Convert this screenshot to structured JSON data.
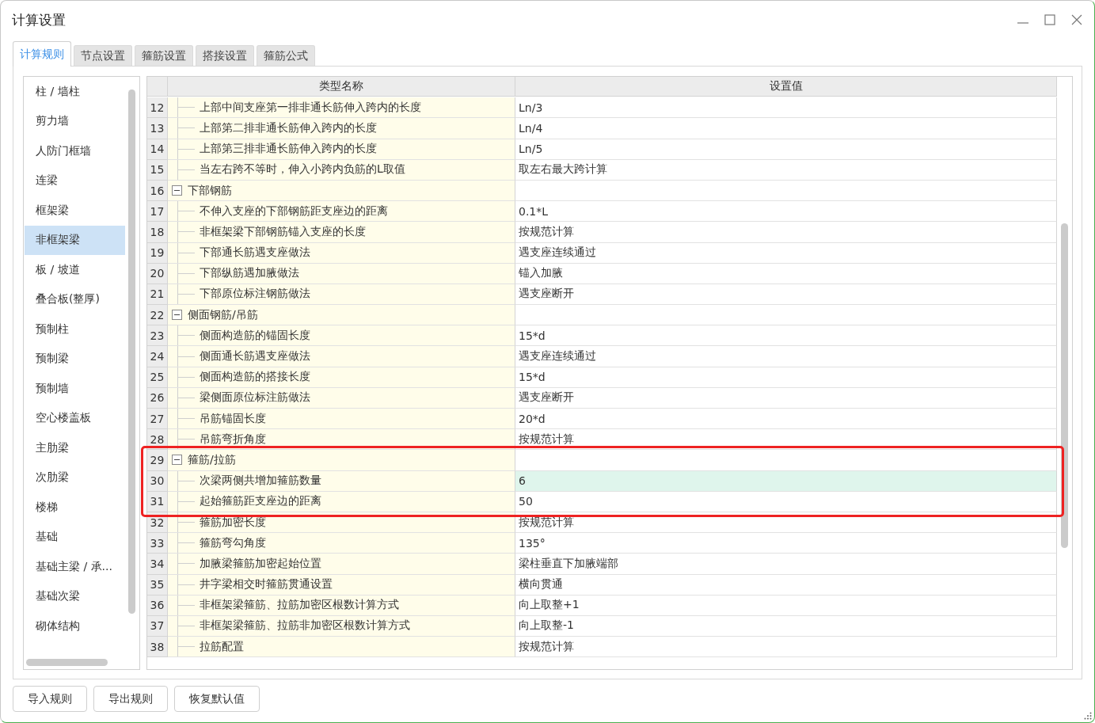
{
  "window": {
    "title": "计算设置"
  },
  "tabs": [
    {
      "label": "计算规则",
      "selected": true
    },
    {
      "label": "节点设置",
      "selected": false
    },
    {
      "label": "箍筋设置",
      "selected": false
    },
    {
      "label": "搭接设置",
      "selected": false
    },
    {
      "label": "箍筋公式",
      "selected": false
    }
  ],
  "sidebar": {
    "items": [
      {
        "label": "柱 / 墙柱",
        "selected": false
      },
      {
        "label": "剪力墙",
        "selected": false
      },
      {
        "label": "人防门框墙",
        "selected": false
      },
      {
        "label": "连梁",
        "selected": false
      },
      {
        "label": "框架梁",
        "selected": false
      },
      {
        "label": "非框架梁",
        "selected": true
      },
      {
        "label": "板 / 坡道",
        "selected": false
      },
      {
        "label": "叠合板(整厚)",
        "selected": false
      },
      {
        "label": "预制柱",
        "selected": false
      },
      {
        "label": "预制梁",
        "selected": false
      },
      {
        "label": "预制墙",
        "selected": false
      },
      {
        "label": "空心楼盖板",
        "selected": false
      },
      {
        "label": "主肋梁",
        "selected": false
      },
      {
        "label": "次肋梁",
        "selected": false
      },
      {
        "label": "楼梯",
        "selected": false
      },
      {
        "label": "基础",
        "selected": false
      },
      {
        "label": "基础主梁 / 承...",
        "selected": false
      },
      {
        "label": "基础次梁",
        "selected": false
      },
      {
        "label": "砌体结构",
        "selected": false
      }
    ]
  },
  "table": {
    "columns": [
      "类型名称",
      "设置值"
    ],
    "rows": [
      {
        "kind": "item",
        "number": "12",
        "name": "上部中间支座第一排非通长筋伸入跨内的长度",
        "value": "Ln/3",
        "selected": false
      },
      {
        "kind": "item",
        "number": "13",
        "name": "上部第二排非通长筋伸入跨内的长度",
        "value": "Ln/4",
        "selected": false
      },
      {
        "kind": "item",
        "number": "14",
        "name": "上部第三排非通长筋伸入跨内的长度",
        "value": "Ln/5",
        "selected": false
      },
      {
        "kind": "item",
        "number": "15",
        "name": "当左右跨不等时，伸入小跨内负筋的L取值",
        "value": "取左右最大跨计算",
        "selected": false
      },
      {
        "kind": "group",
        "number": "16",
        "name": "下部钢筋",
        "expanded": true,
        "selected": false,
        "children": [
          {
            "kind": "item",
            "number": "17",
            "name": "不伸入支座的下部钢筋距支座边的距离",
            "value": "0.1*L",
            "selected": false
          },
          {
            "kind": "item",
            "number": "18",
            "name": "非框架梁下部钢筋锚入支座的长度",
            "value": "按规范计算",
            "selected": false
          },
          {
            "kind": "item",
            "number": "19",
            "name": "下部通长筋遇支座做法",
            "value": "遇支座连续通过",
            "selected": false
          },
          {
            "kind": "item",
            "number": "20",
            "name": "下部纵筋遇加腋做法",
            "value": "锚入加腋",
            "selected": false
          },
          {
            "kind": "item",
            "number": "21",
            "name": "下部原位标注钢筋做法",
            "value": "遇支座断开",
            "selected": false
          }
        ]
      },
      {
        "kind": "group",
        "number": "22",
        "name": "侧面钢筋/吊筋",
        "expanded": true,
        "selected": false,
        "children": [
          {
            "kind": "item",
            "number": "23",
            "name": "侧面构造筋的锚固长度",
            "value": "15*d",
            "selected": false
          },
          {
            "kind": "item",
            "number": "24",
            "name": "侧面通长筋遇支座做法",
            "value": "遇支座连续通过",
            "selected": false
          },
          {
            "kind": "item",
            "number": "25",
            "name": "侧面构造筋的搭接长度",
            "value": "15*d",
            "selected": false
          },
          {
            "kind": "item",
            "number": "26",
            "name": "梁侧面原位标注筋做法",
            "value": "遇支座断开",
            "selected": false
          },
          {
            "kind": "item",
            "number": "27",
            "name": "吊筋锚固长度",
            "value": "20*d",
            "selected": false
          },
          {
            "kind": "item",
            "number": "28",
            "name": "吊筋弯折角度",
            "value": "按规范计算",
            "selected": false
          }
        ]
      },
      {
        "kind": "group",
        "number": "29",
        "name": "箍筋/拉筋",
        "expanded": true,
        "selected": false,
        "children": [
          {
            "kind": "item",
            "number": "30",
            "name": "次梁两侧共增加箍筋数量",
            "value": "6",
            "selected": true
          },
          {
            "kind": "item",
            "number": "31",
            "name": "起始箍筋距支座边的距离",
            "value": "50",
            "selected": false
          },
          {
            "kind": "item",
            "number": "32",
            "name": "箍筋加密长度",
            "value": "按规范计算",
            "selected": false
          },
          {
            "kind": "item",
            "number": "33",
            "name": "箍筋弯勾角度",
            "value": "135°",
            "selected": false
          },
          {
            "kind": "item",
            "number": "34",
            "name": "加腋梁箍筋加密起始位置",
            "value": "梁柱垂直下加腋端部",
            "selected": false
          },
          {
            "kind": "item",
            "number": "35",
            "name": "井字梁相交时箍筋贯通设置",
            "value": "横向贯通",
            "selected": false
          },
          {
            "kind": "item",
            "number": "36",
            "name": "非框架梁箍筋、拉筋加密区根数计算方式",
            "value": "向上取整+1",
            "selected": false
          },
          {
            "kind": "item",
            "number": "37",
            "name": "非框架梁箍筋、拉筋非加密区根数计算方式",
            "value": "向上取整-1",
            "selected": false
          },
          {
            "kind": "item",
            "number": "38",
            "name": "拉筋配置",
            "value": "按规范计算",
            "selected": false
          }
        ]
      }
    ]
  },
  "buttons": [
    "导入规则",
    "导出规则",
    "恢复默认值"
  ]
}
